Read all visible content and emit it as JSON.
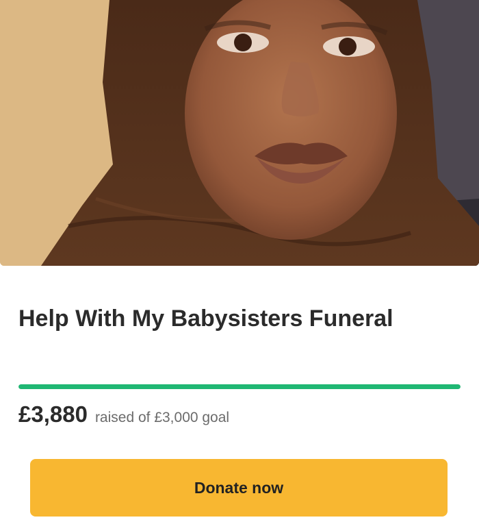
{
  "campaign": {
    "title": "Help With My Babysisters Funeral",
    "amount_raised": "£3,880",
    "goal_text": "raised of £3,000 goal",
    "progress_fraction": 1.0,
    "donate_label": "Donate now"
  },
  "colors": {
    "progress": "#1fb773",
    "button": "#f8b731",
    "text": "#2b2b2b",
    "muted": "#6b6b6b"
  }
}
